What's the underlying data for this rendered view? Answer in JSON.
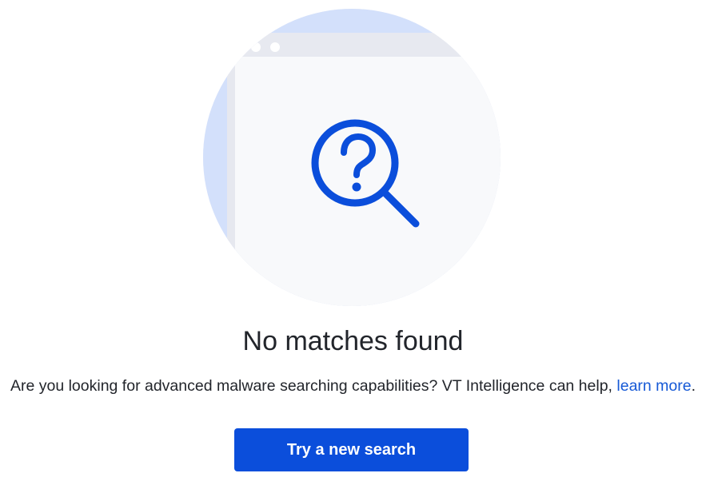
{
  "empty_state": {
    "title": "No matches found",
    "message": "Are you looking for advanced malware searching capabilities? VT Intelligence can help,",
    "link_text": "learn more",
    "message_end": ".",
    "button_label": "Try a new search"
  },
  "colors": {
    "accent": "#0b4edb",
    "link": "#1659d6",
    "circle_bg": "#eef0f6",
    "circle_blue": "#d3e0fb",
    "text": "#22252b"
  },
  "icons": {
    "illustration": "search-question-icon"
  }
}
